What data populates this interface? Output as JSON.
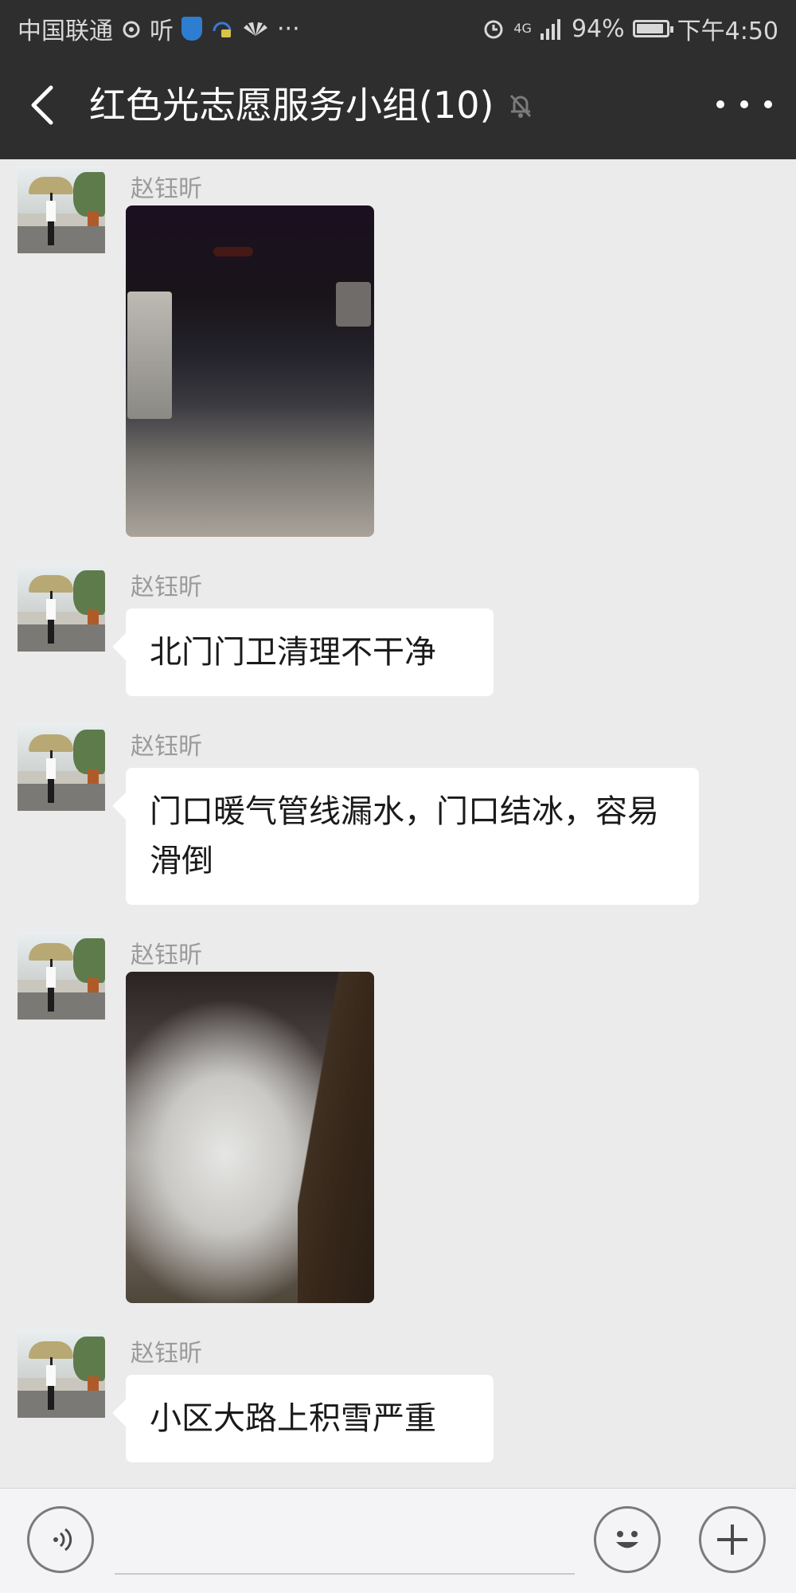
{
  "status_bar": {
    "carrier": "中国联通",
    "app_text": "听",
    "more": "···",
    "network": "4G",
    "battery": "94%",
    "battery_level": 0.94,
    "time": "下午4:50"
  },
  "header": {
    "title": "红色光志愿服务小组(10)"
  },
  "messages": [
    {
      "sender": "赵钰昕",
      "type": "image"
    },
    {
      "sender": "赵钰昕",
      "type": "text",
      "text": "北门门卫清理不干净"
    },
    {
      "sender": "赵钰昕",
      "type": "text",
      "text": "门口暖气管线漏水，门口结冰，容易滑倒"
    },
    {
      "sender": "赵钰昕",
      "type": "image"
    },
    {
      "sender": "赵钰昕",
      "type": "text",
      "text": "小区大路上积雪严重"
    }
  ],
  "input_bar": {
    "placeholder": ""
  },
  "colors": {
    "header_bg": "#2e2e2e",
    "chat_bg": "#ebebeb",
    "bubble_bg": "#ffffff"
  }
}
